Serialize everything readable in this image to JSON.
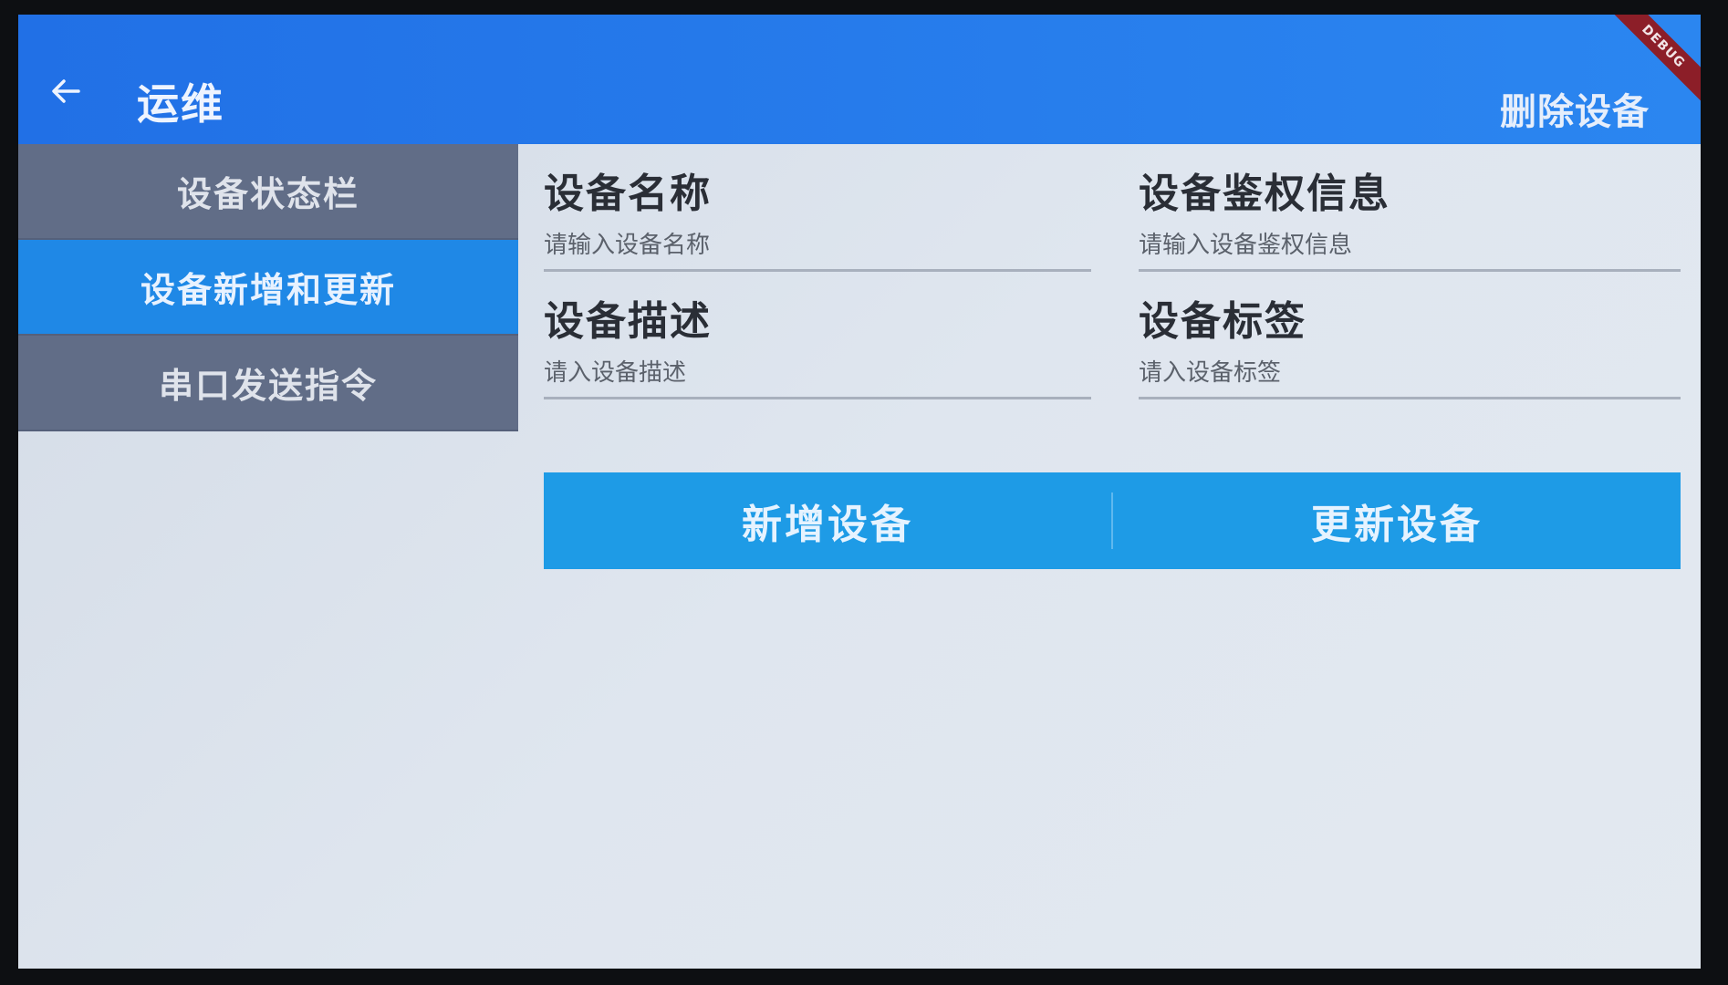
{
  "appbar": {
    "title": "运维",
    "back_icon": "arrow-left-icon",
    "action_label": "删除设备",
    "debug_label": "DEBUG",
    "colors": {
      "background": "#2170e6",
      "debug_banner": "#8c1e28"
    }
  },
  "sidebar": {
    "items": [
      {
        "label": "设备状态栏",
        "active": false
      },
      {
        "label": "设备新增和更新",
        "active": true
      },
      {
        "label": "串口发送指令",
        "active": false
      }
    ],
    "colors": {
      "inactive": "#616d87",
      "active": "#1f88e6"
    }
  },
  "form": {
    "name": {
      "label": "设备名称",
      "placeholder": "请输入设备名称",
      "value": ""
    },
    "auth": {
      "label": "设备鉴权信息",
      "placeholder": "请输入设备鉴权信息",
      "value": ""
    },
    "desc": {
      "label": "设备描述",
      "placeholder": "请入设备描述",
      "value": ""
    },
    "tag": {
      "label": "设备标签",
      "placeholder": "请入设备标签",
      "value": ""
    }
  },
  "buttons": {
    "add_label": "新增设备",
    "update_label": "更新设备",
    "color": "#1e9be6"
  }
}
